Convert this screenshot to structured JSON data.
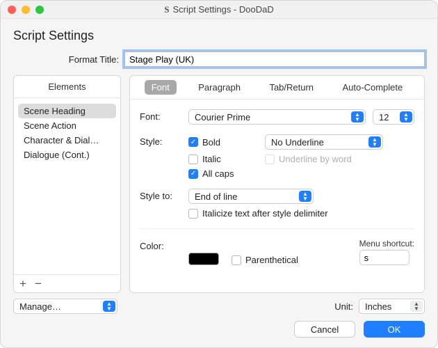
{
  "window": {
    "title": "Script Settings - DooDaD",
    "app_icon_letter": "S"
  },
  "page_title": "Script Settings",
  "format": {
    "label": "Format Title:",
    "value": "Stage Play (UK)"
  },
  "sidebar": {
    "header": "Elements",
    "items": [
      {
        "label": "Scene Heading",
        "selected": true
      },
      {
        "label": "Scene Action",
        "selected": false
      },
      {
        "label": "Character & Dial…",
        "selected": false
      },
      {
        "label": "Dialogue (Cont.)",
        "selected": false
      }
    ],
    "add_glyph": "+",
    "remove_glyph": "−"
  },
  "tabs": [
    {
      "label": "Font",
      "active": true
    },
    {
      "label": "Paragraph",
      "active": false
    },
    {
      "label": "Tab/Return",
      "active": false
    },
    {
      "label": "Auto-Complete",
      "active": false
    }
  ],
  "font_panel": {
    "font_label": "Font:",
    "font_name": "Courier Prime",
    "font_size": "12",
    "style_label": "Style:",
    "bold": {
      "label": "Bold",
      "checked": true
    },
    "italic": {
      "label": "Italic",
      "checked": false
    },
    "allcaps": {
      "label": "All caps",
      "checked": true
    },
    "underline_value": "No Underline",
    "underline_by_word": {
      "label": "Underline by word",
      "checked": false
    },
    "style_to_label": "Style to:",
    "style_to_value": "End of line",
    "italicize_after": {
      "label": "Italicize text after style delimiter",
      "checked": false
    },
    "color_label": "Color:",
    "color_value": "#000000",
    "parenthetical": {
      "label": "Parenthetical",
      "checked": false
    },
    "shortcut_label": "Menu shortcut:",
    "shortcut_value": "s"
  },
  "manage": {
    "label": "Manage…"
  },
  "unit": {
    "label": "Unit:",
    "value": "Inches"
  },
  "buttons": {
    "cancel": "Cancel",
    "ok": "OK"
  }
}
